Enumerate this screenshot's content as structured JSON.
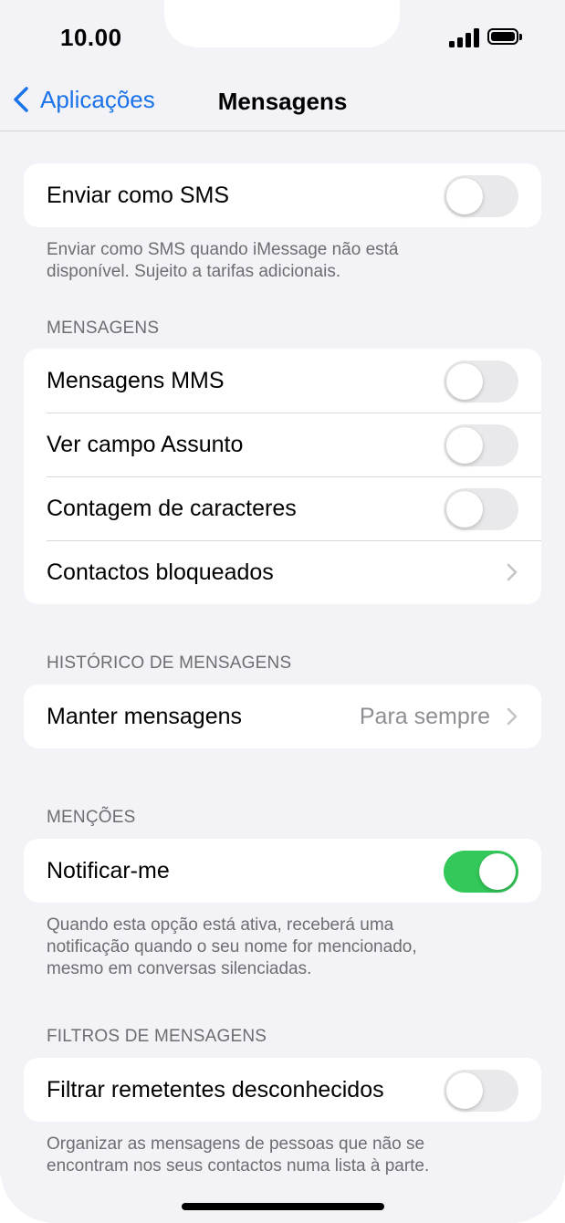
{
  "status_bar": {
    "time": "10.00"
  },
  "nav": {
    "back_label": "Aplicações",
    "title": "Mensagens"
  },
  "send_as_sms": {
    "label": "Enviar como SMS",
    "enabled": false,
    "footer_line1": "Enviar como SMS quando iMessage não está",
    "footer_line2": "disponível. Sujeito a tarifas adicionais."
  },
  "messages_section": {
    "header": "MENSAGENS",
    "rows": [
      {
        "label": "Mensagens MMS",
        "enabled": false
      },
      {
        "label": "Ver campo Assunto",
        "enabled": false
      },
      {
        "label": "Contagem de caracteres",
        "enabled": false
      },
      {
        "label": "Contactos bloqueados"
      }
    ]
  },
  "history_section": {
    "header": "HISTÓRICO DE MENSAGENS",
    "keep_messages_label": "Manter mensagens",
    "keep_messages_value": "Para sempre"
  },
  "mentions_section": {
    "header": "MENÇÕES",
    "notify_label": "Notificar-me",
    "notify_enabled": true,
    "footer_line1": "Quando esta opção está ativa, receberá uma",
    "footer_line2": "notificação quando o seu nome for mencionado,",
    "footer_line3": "mesmo em conversas silenciadas."
  },
  "filters_section": {
    "header": "FILTROS DE MENSAGENS",
    "filter_label": "Filtrar remetentes desconhecidos",
    "filter_enabled": false,
    "footer_line1": "Organizar as mensagens de pessoas que não se",
    "footer_line2": "encontram nos seus contactos numa lista à parte."
  },
  "colors": {
    "accent": "#1a73e8",
    "toggle_on": "#34c759",
    "toggle_off": "#e9e9eb",
    "background": "#f2f2f7"
  }
}
